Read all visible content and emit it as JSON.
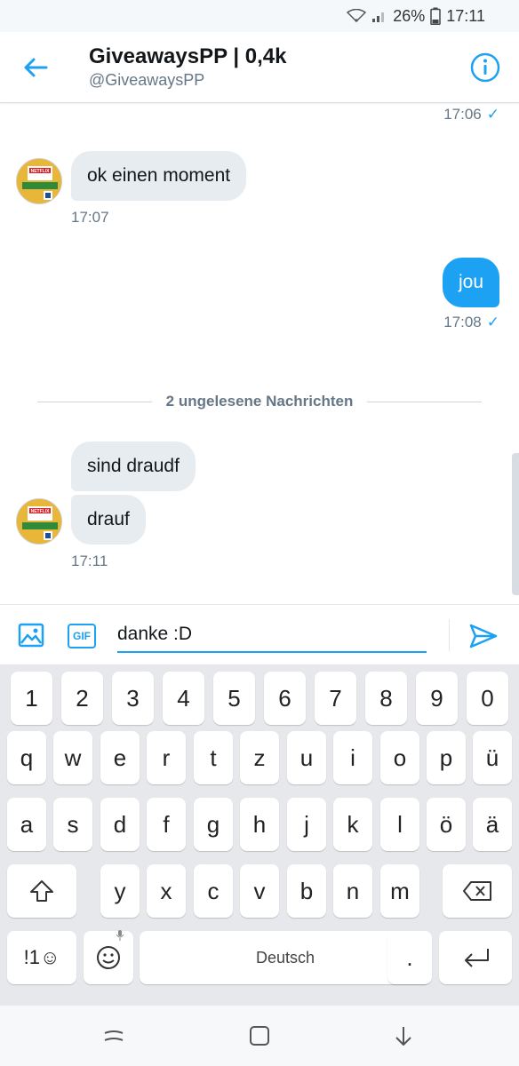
{
  "status_bar": {
    "battery": "26%",
    "time": "17:11"
  },
  "header": {
    "title": "GiveawaysPP | 0,4k",
    "handle": "@GiveawaysPP"
  },
  "messages": {
    "top_time": "17:06",
    "msg1": {
      "text": "ok einen moment",
      "time": "17:07"
    },
    "msg2": {
      "text": "jou",
      "time": "17:08"
    },
    "divider": "2 ungelesene Nachrichten",
    "msg3": {
      "text": "sind draudf"
    },
    "msg4": {
      "text": "drauf",
      "time": "17:11"
    },
    "check": "✓"
  },
  "avatar": {
    "badge": "NETFLIX"
  },
  "composer": {
    "value": "danke :D",
    "gif_label": "GIF"
  },
  "keyboard": {
    "row1": [
      "1",
      "2",
      "3",
      "4",
      "5",
      "6",
      "7",
      "8",
      "9",
      "0"
    ],
    "row2": [
      "q",
      "w",
      "e",
      "r",
      "t",
      "z",
      "u",
      "i",
      "o",
      "p",
      "ü"
    ],
    "row3": [
      "a",
      "s",
      "d",
      "f",
      "g",
      "h",
      "j",
      "k",
      "l",
      "ö",
      "ä"
    ],
    "row4": [
      "y",
      "x",
      "c",
      "v",
      "b",
      "n",
      "m"
    ],
    "symbols_label": "!1☺",
    "space_label": "Deutsch",
    "period": "."
  },
  "colors": {
    "accent": "#1da1f2",
    "bubble_in": "#e6ecf0",
    "keyboard_bg": "#e6e8eb"
  }
}
